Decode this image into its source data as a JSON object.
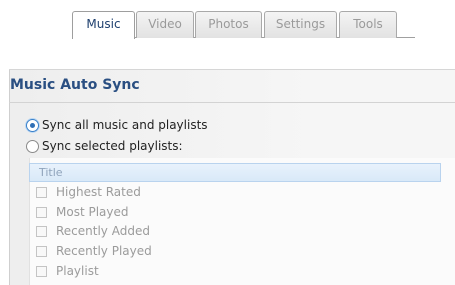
{
  "tabs": [
    {
      "label": "Music",
      "active": true
    },
    {
      "label": "Video",
      "active": false
    },
    {
      "label": "Photos",
      "active": false
    },
    {
      "label": "Settings",
      "active": false
    },
    {
      "label": "Tools",
      "active": false
    }
  ],
  "section": {
    "title": "Music Auto Sync"
  },
  "sync_options": [
    {
      "label": "Sync all music and playlists",
      "selected": true
    },
    {
      "label": "Sync selected playlists:",
      "selected": false
    }
  ],
  "playlist_table": {
    "header": "Title",
    "items": [
      "Highest Rated",
      "Most Played",
      "Recently Added",
      "Recently Played",
      "Playlist"
    ]
  },
  "colors": {
    "accent": "#2a4f82",
    "selection": "#d9e9f8"
  }
}
